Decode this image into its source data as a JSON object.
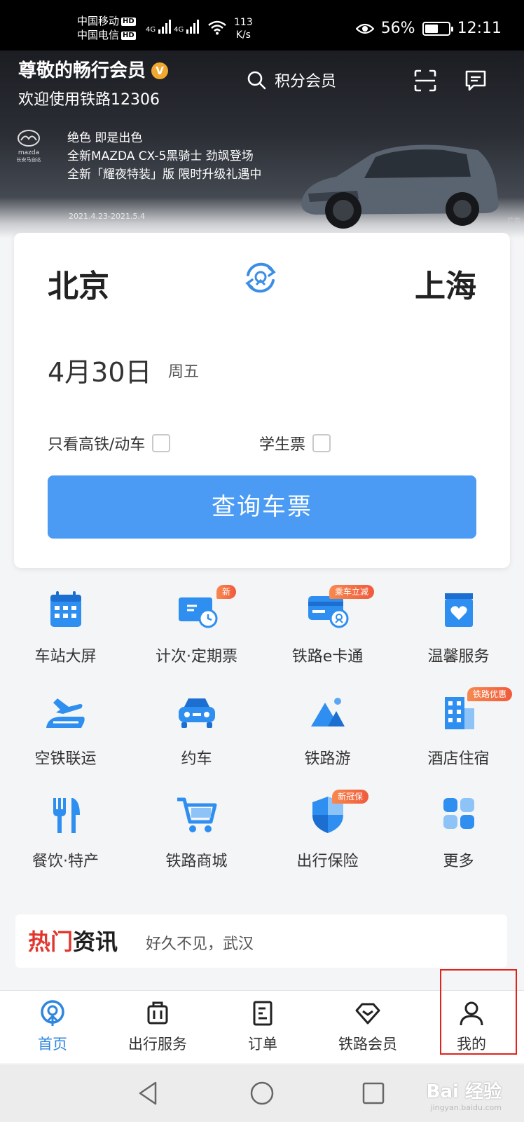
{
  "status_bar": {
    "carrier1": "中国移动",
    "carrier2": "中国电信",
    "hd": "HD",
    "net1": "4G",
    "net2": "4G",
    "speed_value": "113",
    "speed_unit": "K/s",
    "battery_percent": "56%",
    "battery_level": 0.56,
    "time": "12:11"
  },
  "header": {
    "member_title": "尊敬的畅行会员",
    "badge": "V",
    "welcome": "欢迎使用铁路12306",
    "search_label": "积分会员"
  },
  "ad": {
    "brand": "mazda",
    "brand_sub": "长安马自达",
    "line1": "绝色 即是出色",
    "line2": "全新MAZDA CX-5黑骑士 劲飒登场",
    "line3": "全新「耀夜特装」版 限时升级礼遇中",
    "date_range": "2021.4.23-2021.5.4",
    "tag": "广告"
  },
  "search": {
    "from_city": "北京",
    "to_city": "上海",
    "date": "4月30日",
    "weekday": "周五",
    "option_highspeed": "只看高铁/动车",
    "option_student": "学生票",
    "query_button": "查询车票"
  },
  "services": [
    {
      "label": "车站大屏",
      "icon": "calendar-icon",
      "badge": ""
    },
    {
      "label": "计次·定期票",
      "icon": "ticket-clock-icon",
      "badge": "新"
    },
    {
      "label": "铁路e卡通",
      "icon": "card-icon",
      "badge": "乘车立减"
    },
    {
      "label": "温馨服务",
      "icon": "heart-bag-icon",
      "badge": ""
    },
    {
      "label": "空铁联运",
      "icon": "plane-train-icon",
      "badge": ""
    },
    {
      "label": "约车",
      "icon": "car-icon",
      "badge": ""
    },
    {
      "label": "铁路游",
      "icon": "mountain-icon",
      "badge": ""
    },
    {
      "label": "酒店住宿",
      "icon": "hotel-icon",
      "badge": "铁路优惠"
    },
    {
      "label": "餐饮·特产",
      "icon": "fork-knife-icon",
      "badge": ""
    },
    {
      "label": "铁路商城",
      "icon": "cart-icon",
      "badge": ""
    },
    {
      "label": "出行保险",
      "icon": "shield-icon",
      "badge": "新冠保"
    },
    {
      "label": "更多",
      "icon": "grid-icon",
      "badge": ""
    }
  ],
  "news": {
    "title_hot": "热门",
    "title_rest": "资讯",
    "headline": "好久不见，武汉"
  },
  "tabs": [
    {
      "label": "首页",
      "icon": "home-logo-icon",
      "active": true
    },
    {
      "label": "出行服务",
      "icon": "luggage-icon",
      "active": false
    },
    {
      "label": "订单",
      "icon": "order-icon",
      "active": false
    },
    {
      "label": "铁路会员",
      "icon": "diamond-icon",
      "active": false
    },
    {
      "label": "我的",
      "icon": "person-icon",
      "active": false
    }
  ],
  "watermark": {
    "text": "Bai 经验",
    "url": "jingyan.baidu.com"
  },
  "colors": {
    "primary": "#4b9bf5",
    "active_tab": "#2e86de",
    "badge": "#f05a3c",
    "highlight": "#e3221b"
  }
}
